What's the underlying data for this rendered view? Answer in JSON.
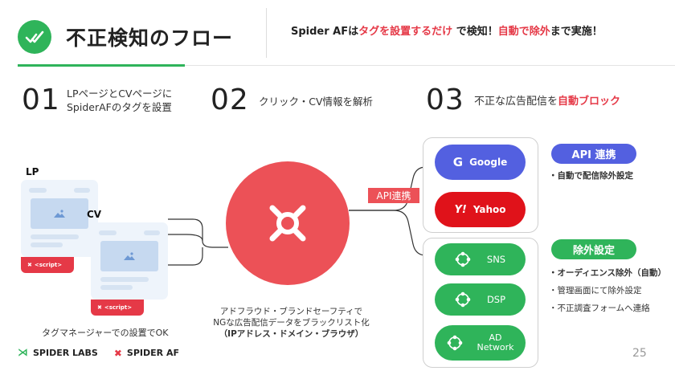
{
  "header": {
    "title": "不正検知のフロー",
    "tagline_pre": "Spider AFは",
    "tagline_highlight1": "タグを設置するだけ",
    "tagline_mid": "で検知！",
    "tagline_highlight2": "自動で除外",
    "tagline_post": "まで実施！"
  },
  "steps": [
    {
      "num": "01",
      "line1": "LPページとCVページに",
      "line2": "SpiderAFのタグを設置"
    },
    {
      "num": "02",
      "text": "クリック・CV情報を解析"
    },
    {
      "num": "03",
      "text_pre": "不正な広告配信を",
      "text_highlight": "自動ブロック"
    }
  ],
  "left": {
    "lp_label": "LP",
    "cv_label": "CV",
    "script_label": "<script>",
    "note": "タグマネージャーでの設置でOK"
  },
  "center": {
    "api_badge": "API連携",
    "caption_line1": "アドフラウド・ブランドセーフティで",
    "caption_line2": "NGな広告配信データをブラックリスト化",
    "caption_line3": "（IPアドレス・ドメイン・ブラウザ）"
  },
  "right": {
    "api_group": {
      "title": "API 連携",
      "note": "・自動で配信除外設定",
      "items": [
        {
          "label": "Google",
          "icon": "google-g-icon"
        },
        {
          "label": "Yahoo",
          "icon": "yahoo-logo-icon"
        }
      ]
    },
    "exclude_group": {
      "title": "除外設定",
      "notes": [
        "・オーディエンス除外（自動）",
        "・管理画面にて除外設定",
        "・不正調査フォームへ連絡"
      ],
      "items": [
        {
          "label": "SNS",
          "icon": "network-icon"
        },
        {
          "label": "DSP",
          "icon": "network-icon"
        },
        {
          "label_line1": "AD",
          "label_line2": "Network",
          "icon": "network-icon"
        }
      ]
    }
  },
  "footer": {
    "brand1": "SPIDER LABS",
    "brand2": "SPIDER AF",
    "page": "25"
  },
  "colors": {
    "green": "#2fb45a",
    "red": "#ec5157",
    "accent_red_text": "#e53947",
    "google_blue": "#5360e0",
    "yahoo_red": "#e0121a"
  }
}
